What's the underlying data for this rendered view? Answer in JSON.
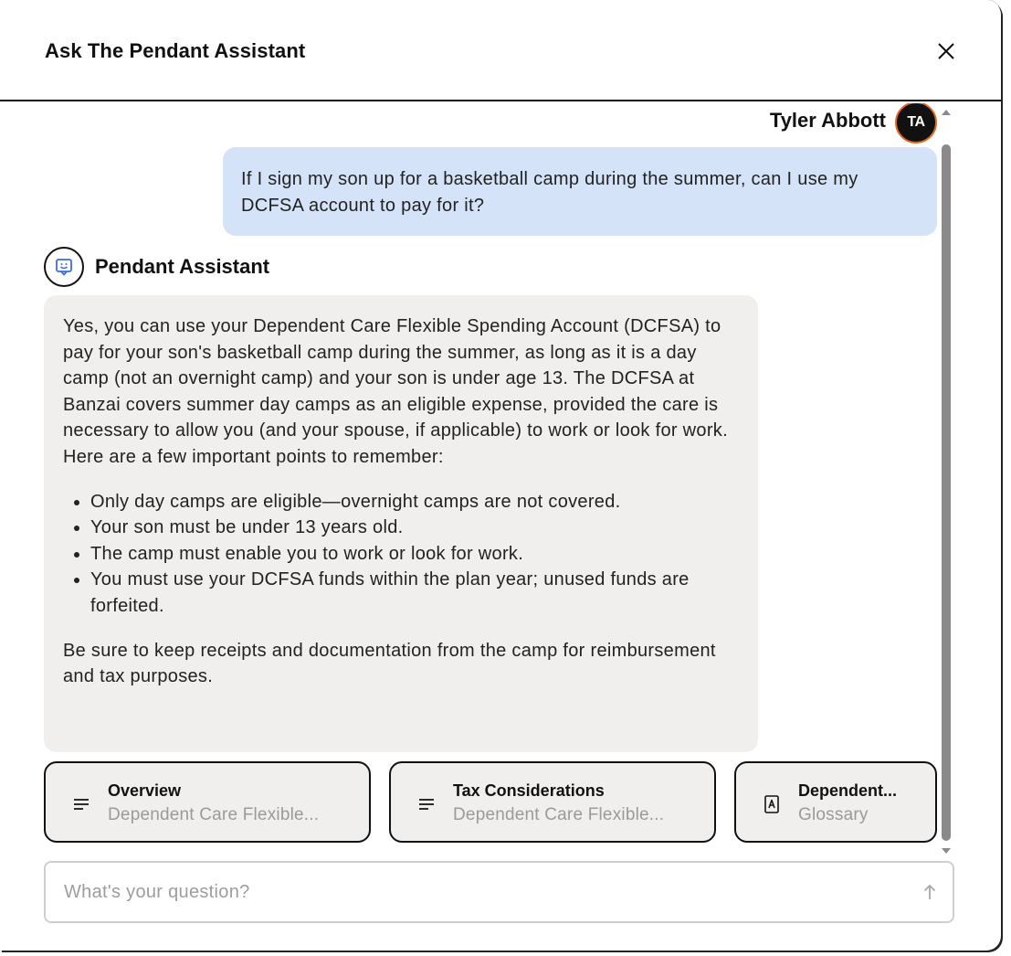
{
  "header": {
    "title": "Ask The Pendant Assistant",
    "close_icon": "close-icon"
  },
  "user": {
    "name": "Tyler Abbott",
    "initials": "TA",
    "avatar_border_color": "#e2671f"
  },
  "user_message": "If I sign my son up for a basketball camp during the summer, can I use my DCFSA account to pay for it?",
  "assistant": {
    "name": "Pendant Assistant",
    "icon": "assistant-chat-icon",
    "answer_intro": "Yes, you can use your Dependent Care Flexible Spending Account (DCFSA) to pay for your son's basketball camp during the summer, as long as it is a day camp (not an overnight camp) and your son is under age 13. The DCFSA at Banzai covers summer day camps as an eligible expense, provided the care is necessary to allow you (and your spouse, if applicable) to work or look for work. Here are a few important points to remember:",
    "points": [
      "Only day camps are eligible—overnight camps are not covered.",
      "Your son must be under 13 years old.",
      "The camp must enable you to work or look for work.",
      "You must use your DCFSA funds within the plan year; unused funds are forfeited."
    ],
    "answer_outro": "Be sure to keep receipts and documentation from the camp for reimbursement and tax purposes."
  },
  "sources": [
    {
      "title": "Overview",
      "subtitle": "Dependent Care Flexible...",
      "icon": "text-lines-icon"
    },
    {
      "title": "Tax Considerations",
      "subtitle": "Dependent Care Flexible...",
      "icon": "text-lines-icon"
    },
    {
      "title": "Dependent...",
      "subtitle": "Glossary",
      "icon": "glossary-icon"
    }
  ],
  "input": {
    "placeholder": "What's your question?",
    "value": ""
  },
  "colors": {
    "user_bubble": "#d5e3f8",
    "assistant_bubble": "#f0efed",
    "assistant_icon": "#3b6fd6"
  }
}
